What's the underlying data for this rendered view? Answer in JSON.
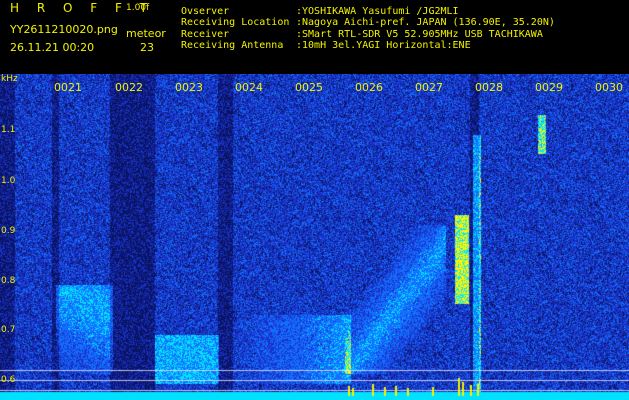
{
  "header": {
    "brand": "H R O F F T",
    "version": "1.00f",
    "filename": "YY2611210020.png",
    "datetime": "26.11.21 00:20",
    "meteor_label": "meteor",
    "meteor_count": "23"
  },
  "info": [
    {
      "key": "Ovserver",
      "value": ":YOSHIKAWA Yasufumi /JG2MLI"
    },
    {
      "key": "Receiving Location",
      "value": ":Nagoya Aichi-pref. JAPAN (136.90E, 35.20N)"
    },
    {
      "key": "Receiver",
      "value": ":SMart RTL-SDR V5 52.905MHz USB TACHIKAWA"
    },
    {
      "key": "Receiving Antenna",
      "value": ":10mH 3el.YAGI Horizontal:ENE"
    }
  ],
  "spectrogram": {
    "unit": "kHz",
    "freq_ticks": [
      "1.1",
      "1.0",
      "0.9",
      "0.8",
      "0.7",
      "0.6"
    ],
    "freq_tick_values": [
      1.1,
      1.0,
      0.9,
      0.8,
      0.7,
      0.6
    ],
    "freq_range_khz": [
      0.55,
      1.17
    ],
    "minute_labels": [
      "0021",
      "0022",
      "0023",
      "0024",
      "0025",
      "0026",
      "0027",
      "0028",
      "0029",
      "0030"
    ],
    "colors": {
      "background": "#0a1466",
      "noise": "#1e3cff",
      "signal": "#00e0ff",
      "strong": "#f2f200",
      "text": "#f2f200"
    }
  }
}
